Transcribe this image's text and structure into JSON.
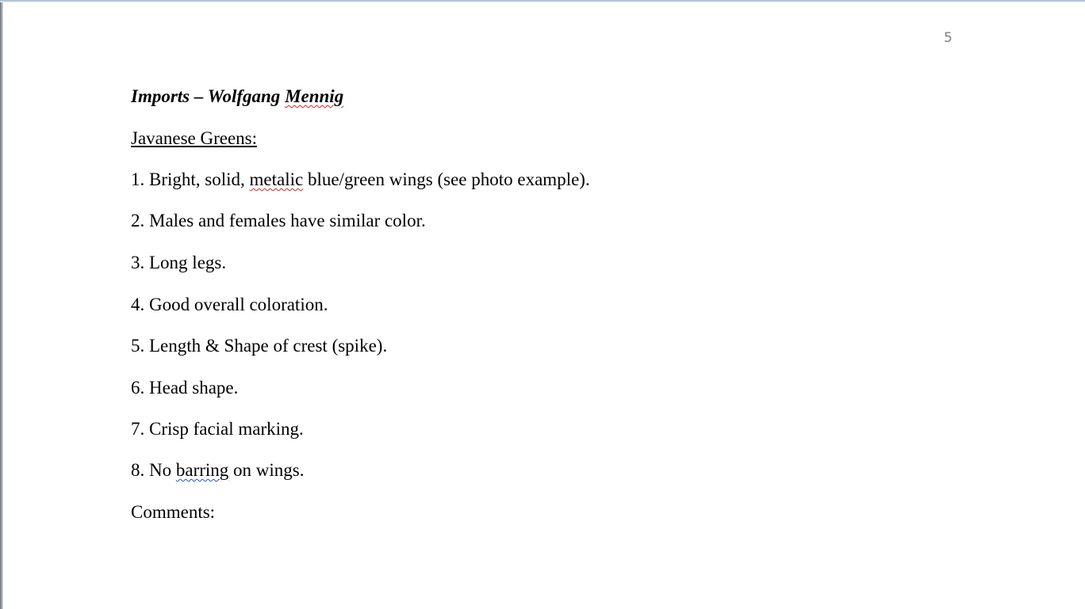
{
  "page_number": "5",
  "document": {
    "title_prefix": "Imports – Wolfgang ",
    "title_name": "Mennig",
    "subtitle": "Javanese Greens:",
    "items": [
      {
        "before": "1. Bright, solid, ",
        "flagged": "metalic",
        "after": " blue/green wings (see photo example)."
      },
      {
        "text": "2. Males and females have similar color."
      },
      {
        "text": "3. Long legs."
      },
      {
        "text": "4. Good overall coloration."
      },
      {
        "text": "5. Length & Shape of crest (spike)."
      },
      {
        "text": "6. Head shape."
      },
      {
        "text": "7. Crisp facial marking."
      },
      {
        "before": "8. No ",
        "flagged": "barring",
        "after": " on wings."
      }
    ],
    "comments_label": "Comments:"
  }
}
